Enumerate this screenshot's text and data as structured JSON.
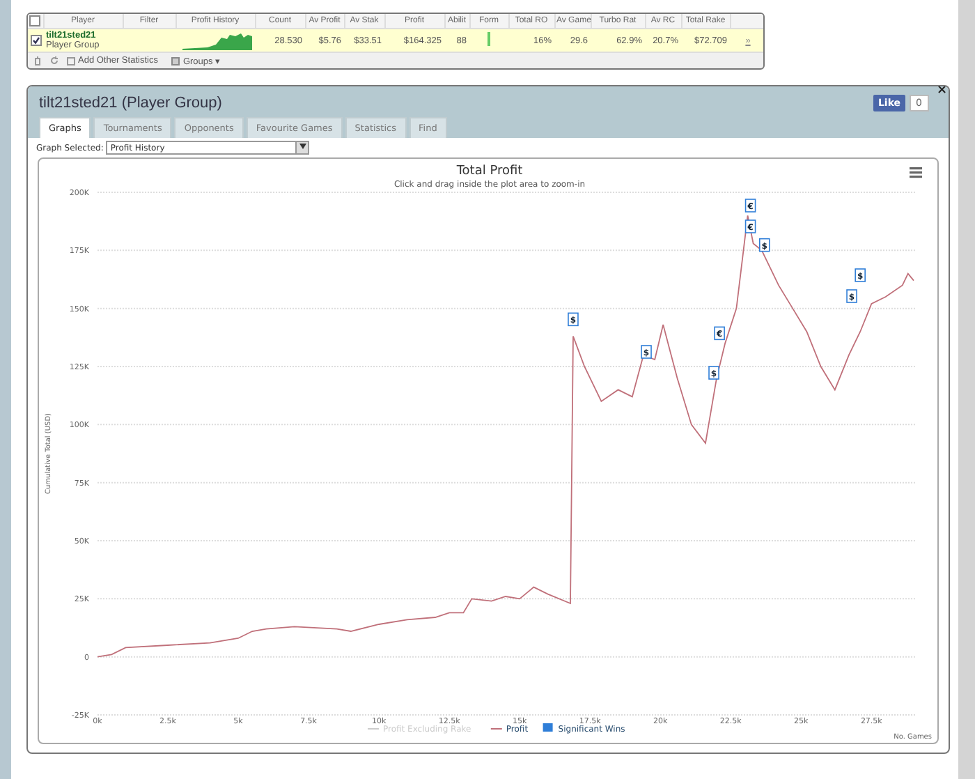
{
  "stats_table": {
    "all_checked": false,
    "columns": [
      "Player",
      "Filter",
      "Profit History",
      "Count",
      "Av Profit",
      "Av Stak",
      "Profit",
      "Abilit",
      "Form",
      "Total RO",
      "Av Game",
      "Turbo Rat",
      "Av RC",
      "Total Rake"
    ],
    "rows": [
      {
        "checked": true,
        "player": "tilt21sted21",
        "group": "Player Group",
        "count": "28.530",
        "av_profit": "$5.76",
        "av_stake": "$33.51",
        "profit": "$164.325",
        "ability": "88",
        "total_roi": "16%",
        "av_games": "29.6",
        "turbo_ratio": "62.9%",
        "av_rc": "20.7%",
        "total_rake": "$72.709",
        "link": "»"
      }
    ],
    "footer": {
      "add_label": "Add Other Statistics",
      "groups_label": "Groups ▾"
    }
  },
  "window": {
    "title": "tilt21sted21 (Player Group)",
    "like_label": "Like",
    "like_count": "0",
    "close": "×",
    "tabs": [
      {
        "label": "Graphs",
        "selected": true
      },
      {
        "label": "Tournaments",
        "selected": false
      },
      {
        "label": "Opponents",
        "selected": false
      },
      {
        "label": "Favourite Games",
        "selected": false
      },
      {
        "label": "Statistics",
        "selected": false
      },
      {
        "label": "Find",
        "selected": false
      }
    ],
    "graph_select": {
      "label": "Graph Selected:",
      "value": "Profit History"
    },
    "chart": {
      "subtitle": "Click and drag inside the plot area to zoom-in",
      "legend": [
        {
          "label": "Profit Excluding Rake",
          "kind": "line",
          "enabled": false,
          "color": "#cccccc"
        },
        {
          "label": "Significant Wins",
          "kind": "box",
          "enabled": true,
          "color": "#2f7ed8"
        }
      ],
      "chart_data": {
        "type": "line",
        "title": "Total Profit",
        "xlabel": "No. Games",
        "ylabel": "Cumulative Total (USD)",
        "grid": true,
        "xlim": [
          0,
          29100
        ],
        "ylim": [
          -25000,
          200000
        ],
        "xticks": [
          {
            "value": 0,
            "label": "0k"
          },
          {
            "value": 2500,
            "label": "2.5k"
          },
          {
            "value": 5000,
            "label": "5k"
          },
          {
            "value": 7500,
            "label": "7.5k"
          },
          {
            "value": 10000,
            "label": "10k"
          },
          {
            "value": 12500,
            "label": "12.5k"
          },
          {
            "value": 15000,
            "label": "15k"
          },
          {
            "value": 17500,
            "label": "17.5k"
          },
          {
            "value": 20000,
            "label": "20k"
          },
          {
            "value": 22500,
            "label": "22.5k"
          },
          {
            "value": 25000,
            "label": "25k"
          },
          {
            "value": 27500,
            "label": "27.5k"
          }
        ],
        "yticks": [
          {
            "value": -25000,
            "label": "-25K"
          },
          {
            "value": 0,
            "label": "0"
          },
          {
            "value": 25000,
            "label": "25K"
          },
          {
            "value": 50000,
            "label": "50K"
          },
          {
            "value": 75000,
            "label": "75K"
          },
          {
            "value": 100000,
            "label": "100K"
          },
          {
            "value": 125000,
            "label": "125K"
          },
          {
            "value": 150000,
            "label": "150K"
          },
          {
            "value": 175000,
            "label": "175K"
          },
          {
            "value": 200000,
            "label": "200K"
          }
        ],
        "x": [
          0,
          500,
          1000,
          2500,
          4000,
          5000,
          5500,
          6000,
          7000,
          8500,
          9000,
          10000,
          11000,
          12000,
          12500,
          13000,
          13300,
          14000,
          14500,
          15000,
          15500,
          16000,
          16800,
          16900,
          17300,
          17900,
          18500,
          19000,
          19400,
          19800,
          20100,
          20600,
          21100,
          21600,
          22000,
          22300,
          22700,
          23100,
          23300,
          23600,
          24200,
          24700,
          25200,
          25700,
          26200,
          26700,
          27100,
          27500,
          28000,
          28600,
          28800,
          29000
        ],
        "series": [
          {
            "name": "Profit",
            "color": "#c0707a",
            "values": [
              0,
              1000,
              4000,
              5000,
              6000,
              8000,
              11000,
              12000,
              13000,
              12000,
              11000,
              14000,
              16000,
              17000,
              19000,
              19000,
              25000,
              24000,
              26000,
              25000,
              30000,
              27000,
              23000,
              138000,
              125000,
              110000,
              115000,
              112000,
              130000,
              128000,
              143000,
              120000,
              100000,
              92000,
              120000,
              135000,
              150000,
              190000,
              178000,
              175000,
              160000,
              150000,
              140000,
              125000,
              115000,
              130000,
              140000,
              152000,
              155000,
              160000,
              165000,
              162000
            ]
          }
        ],
        "annotations": [
          {
            "x": 16900,
            "y": 145000,
            "text": "$"
          },
          {
            "x": 19500,
            "y": 131000,
            "text": "$"
          },
          {
            "x": 21900,
            "y": 122000,
            "text": "$"
          },
          {
            "x": 22100,
            "y": 139000,
            "text": "€"
          },
          {
            "x": 23200,
            "y": 194000,
            "text": "€"
          },
          {
            "x": 23200,
            "y": 185000,
            "text": "€"
          },
          {
            "x": 23700,
            "y": 177000,
            "text": "$"
          },
          {
            "x": 26800,
            "y": 155000,
            "text": "$"
          },
          {
            "x": 27100,
            "y": 164000,
            "text": "$"
          }
        ]
      }
    }
  }
}
